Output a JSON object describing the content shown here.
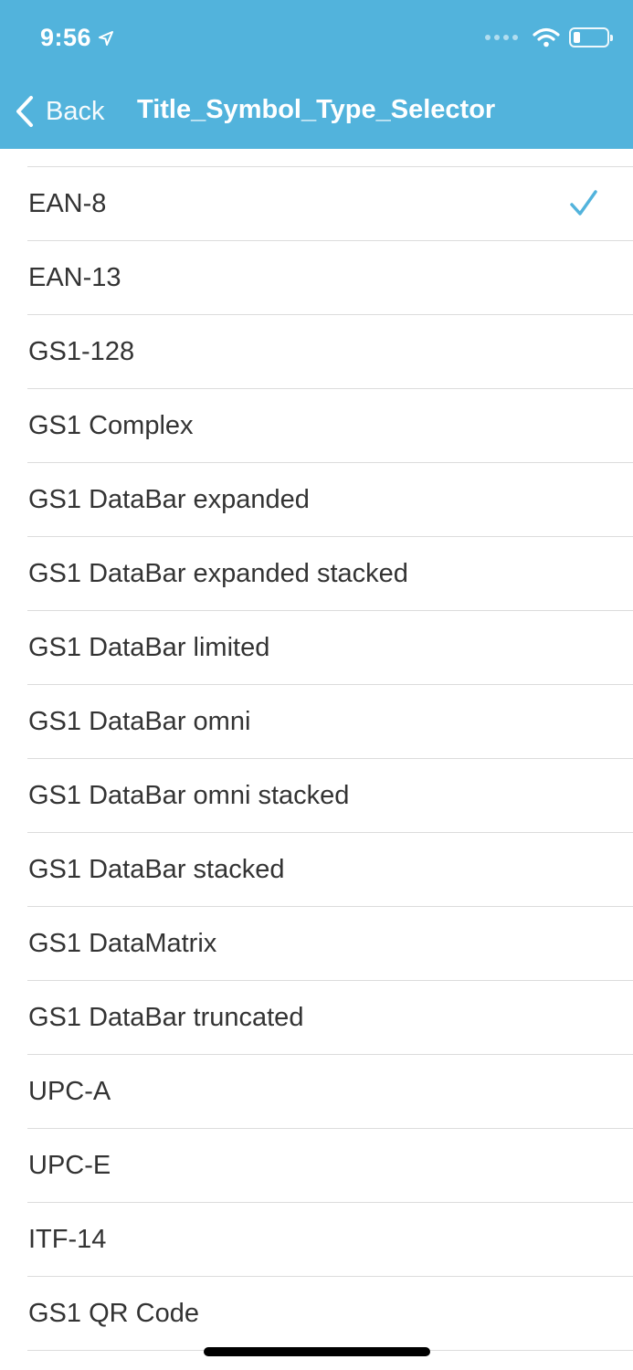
{
  "status_bar": {
    "time": "9:56",
    "battery_level": 0.2
  },
  "nav": {
    "back_label": "Back",
    "title": "Title_Symbol_Type_Selector"
  },
  "list": {
    "items": [
      {
        "label": "EAN-8",
        "selected": true
      },
      {
        "label": "EAN-13",
        "selected": false
      },
      {
        "label": "GS1-128",
        "selected": false
      },
      {
        "label": "GS1 Complex",
        "selected": false
      },
      {
        "label": "GS1 DataBar expanded",
        "selected": false
      },
      {
        "label": "GS1 DataBar expanded stacked",
        "selected": false
      },
      {
        "label": "GS1 DataBar limited",
        "selected": false
      },
      {
        "label": "GS1 DataBar omni",
        "selected": false
      },
      {
        "label": "GS1 DataBar omni stacked",
        "selected": false
      },
      {
        "label": "GS1 DataBar stacked",
        "selected": false
      },
      {
        "label": "GS1 DataMatrix",
        "selected": false
      },
      {
        "label": "GS1 DataBar truncated",
        "selected": false
      },
      {
        "label": "UPC-A",
        "selected": false
      },
      {
        "label": "UPC-E",
        "selected": false
      },
      {
        "label": "ITF-14",
        "selected": false
      },
      {
        "label": "GS1 QR Code",
        "selected": false
      }
    ]
  },
  "colors": {
    "header_bg": "#52b3dc",
    "accent": "#52b3dc",
    "separator": "#dcdcdc",
    "text": "#333333"
  },
  "icons": {
    "back": "chevron-left-icon",
    "selected": "checkmark-icon",
    "location": "location-arrow-icon",
    "wifi": "wifi-icon",
    "battery": "battery-icon",
    "cellular": "cellular-signal-icon"
  }
}
